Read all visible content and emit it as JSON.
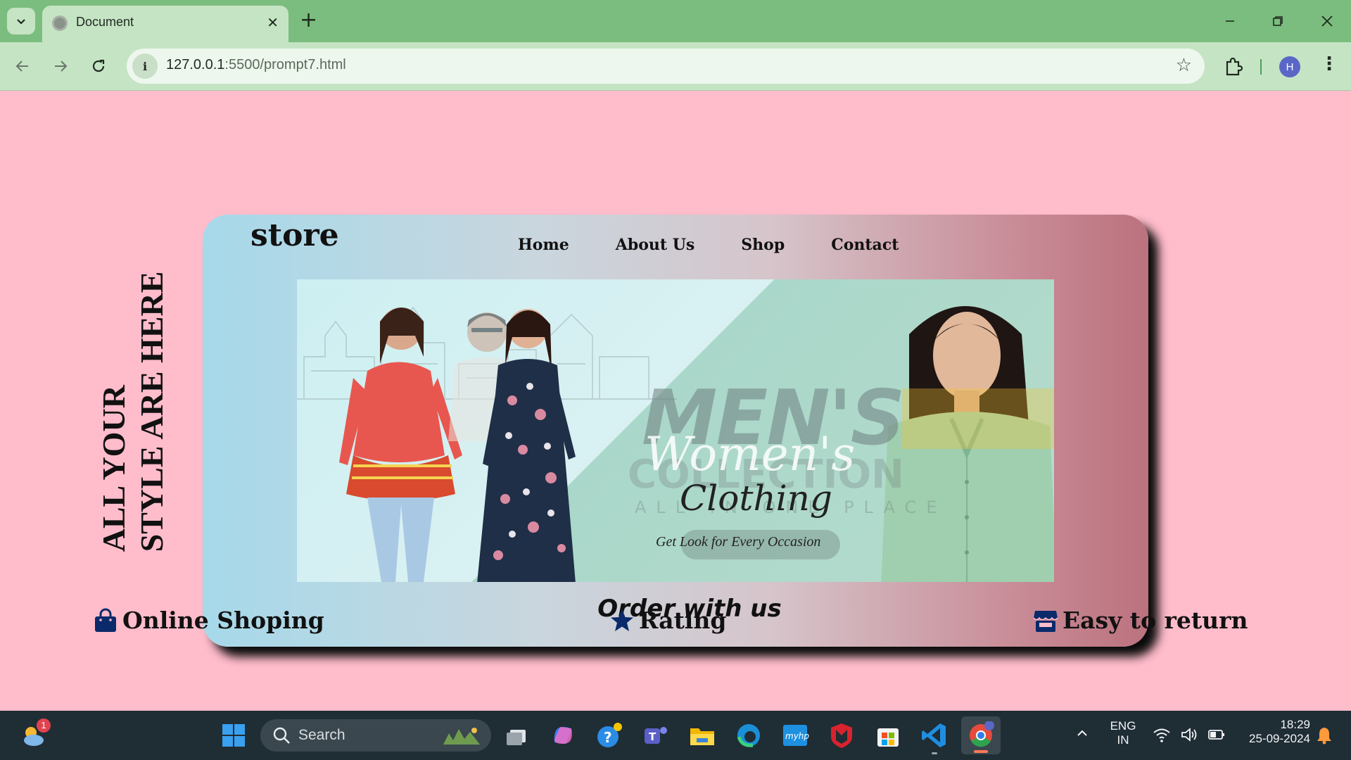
{
  "browser": {
    "tab_title": "Document",
    "tab_close": "✕",
    "new_tab": "+",
    "url_host": "127.0.0.1",
    "url_path": ":5500/prompt7.html",
    "profile_initial": "H",
    "window_controls": {
      "minimize": "—",
      "restore": "❐",
      "close": "✕"
    }
  },
  "page": {
    "side_heading": "ALL YOUR\nSTYLE ARE HERE",
    "brand": "store",
    "nav": [
      "Home",
      "About Us",
      "Shop",
      "Contact"
    ],
    "banner": {
      "overlay_text": "MEN'S",
      "overlay_sub": "COLLECTION",
      "overlay_marketplace": "ALL IN ONE PLACE",
      "headline": "Women's",
      "subheadline": "Clothing",
      "tagline": "Get Look for Every Occasion"
    },
    "order_link": "Order with us",
    "features": [
      {
        "label": "Online Shoping",
        "icon": "shopping-bag-icon"
      },
      {
        "label": "Rating",
        "icon": "star-icon"
      },
      {
        "label": "Easy to return",
        "icon": "store-icon"
      }
    ],
    "colors": {
      "page_bg": "#ffbccb",
      "card_gradient_start": "#a6d9ea",
      "card_gradient_end": "#bb727e",
      "feature_icon": "#0b2a6b"
    }
  },
  "taskbar": {
    "search_placeholder": "Search",
    "weather_badge": "1",
    "language": "ENG",
    "region": "IN",
    "time": "18:29",
    "date": "25-09-2024"
  }
}
